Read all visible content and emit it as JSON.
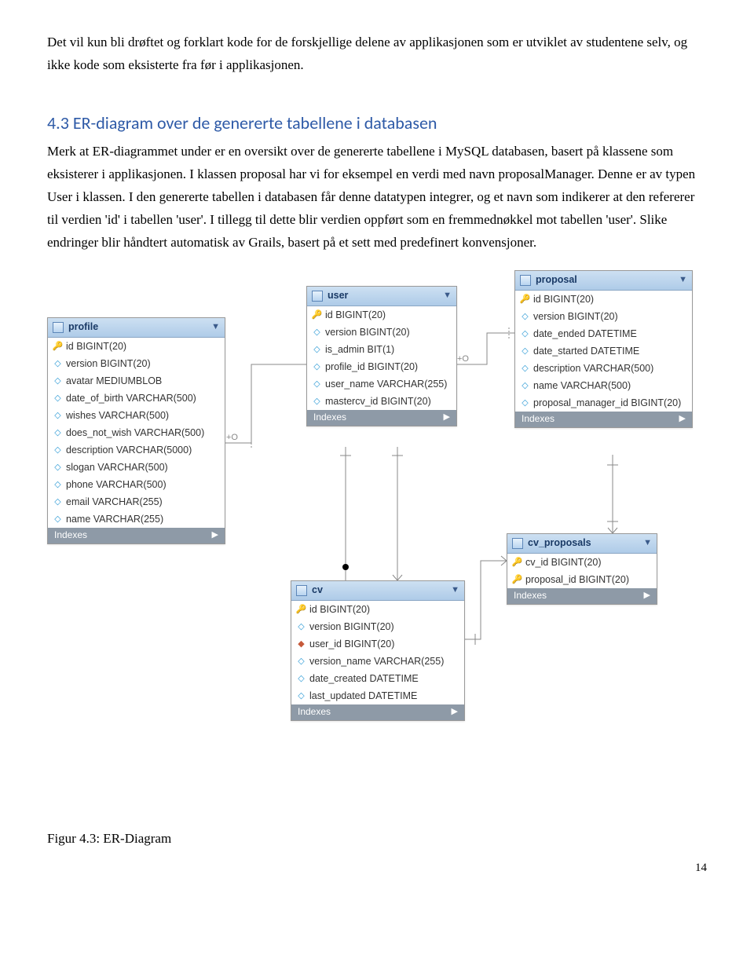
{
  "intro_paragraph": "Det vil kun bli drøftet og forklart kode for de forskjellige delene av applikasjonen som er utviklet av studentene selv, og ikke kode som eksisterte fra før i applikasjonen.",
  "section_heading": "4.3 ER-diagram over de genererte tabellene i databasen",
  "section_body": "Merk at ER-diagrammet under er en oversikt over de genererte tabellene i MySQL databasen, basert på klassene som eksisterer i applikasjonen. I klassen proposal har vi for eksempel en verdi med navn proposalManager. Denne er av typen User i klassen. I den genererte tabellen i databasen får denne datatypen integrer, og et navn som indikerer at den refererer til verdien 'id' i tabellen 'user'. I tillegg til dette blir verdien oppført som en fremmednøkkel mot tabellen 'user'. Slike endringer blir håndtert automatisk av Grails, basert på et sett med predefinert konvensjoner.",
  "figure_caption": "Figur 4.3: ER-Diagram",
  "page_number": "14",
  "indexes_label": "Indexes",
  "tables": {
    "profile": {
      "title": "profile",
      "columns": [
        {
          "icon": "key",
          "label": "id BIGINT(20)"
        },
        {
          "icon": "col",
          "label": "version BIGINT(20)"
        },
        {
          "icon": "col",
          "label": "avatar MEDIUMBLOB"
        },
        {
          "icon": "col",
          "label": "date_of_birth VARCHAR(500)"
        },
        {
          "icon": "col",
          "label": "wishes VARCHAR(500)"
        },
        {
          "icon": "col",
          "label": "does_not_wish VARCHAR(500)"
        },
        {
          "icon": "col",
          "label": "description VARCHAR(5000)"
        },
        {
          "icon": "col",
          "label": "slogan VARCHAR(500)"
        },
        {
          "icon": "col",
          "label": "phone VARCHAR(500)"
        },
        {
          "icon": "col",
          "label": "email VARCHAR(255)"
        },
        {
          "icon": "col",
          "label": "name VARCHAR(255)"
        }
      ]
    },
    "user": {
      "title": "user",
      "columns": [
        {
          "icon": "key",
          "label": "id BIGINT(20)"
        },
        {
          "icon": "col",
          "label": "version BIGINT(20)"
        },
        {
          "icon": "col",
          "label": "is_admin BIT(1)"
        },
        {
          "icon": "col",
          "label": "profile_id BIGINT(20)"
        },
        {
          "icon": "col",
          "label": "user_name VARCHAR(255)"
        },
        {
          "icon": "col",
          "label": "mastercv_id BIGINT(20)"
        }
      ]
    },
    "proposal": {
      "title": "proposal",
      "columns": [
        {
          "icon": "key",
          "label": "id BIGINT(20)"
        },
        {
          "icon": "col",
          "label": "version BIGINT(20)"
        },
        {
          "icon": "col",
          "label": "date_ended DATETIME"
        },
        {
          "icon": "col",
          "label": "date_started DATETIME"
        },
        {
          "icon": "col",
          "label": "description VARCHAR(500)"
        },
        {
          "icon": "col",
          "label": "name VARCHAR(500)"
        },
        {
          "icon": "col",
          "label": "proposal_manager_id BIGINT(20)"
        }
      ]
    },
    "cv": {
      "title": "cv",
      "columns": [
        {
          "icon": "key",
          "label": "id BIGINT(20)"
        },
        {
          "icon": "col",
          "label": "version BIGINT(20)"
        },
        {
          "icon": "colr",
          "label": "user_id BIGINT(20)"
        },
        {
          "icon": "col",
          "label": "version_name VARCHAR(255)"
        },
        {
          "icon": "col",
          "label": "date_created DATETIME"
        },
        {
          "icon": "col",
          "label": "last_updated DATETIME"
        }
      ]
    },
    "cv_proposals": {
      "title": "cv_proposals",
      "columns": [
        {
          "icon": "key",
          "label": "cv_id BIGINT(20)"
        },
        {
          "icon": "key",
          "label": "proposal_id BIGINT(20)"
        }
      ]
    }
  }
}
